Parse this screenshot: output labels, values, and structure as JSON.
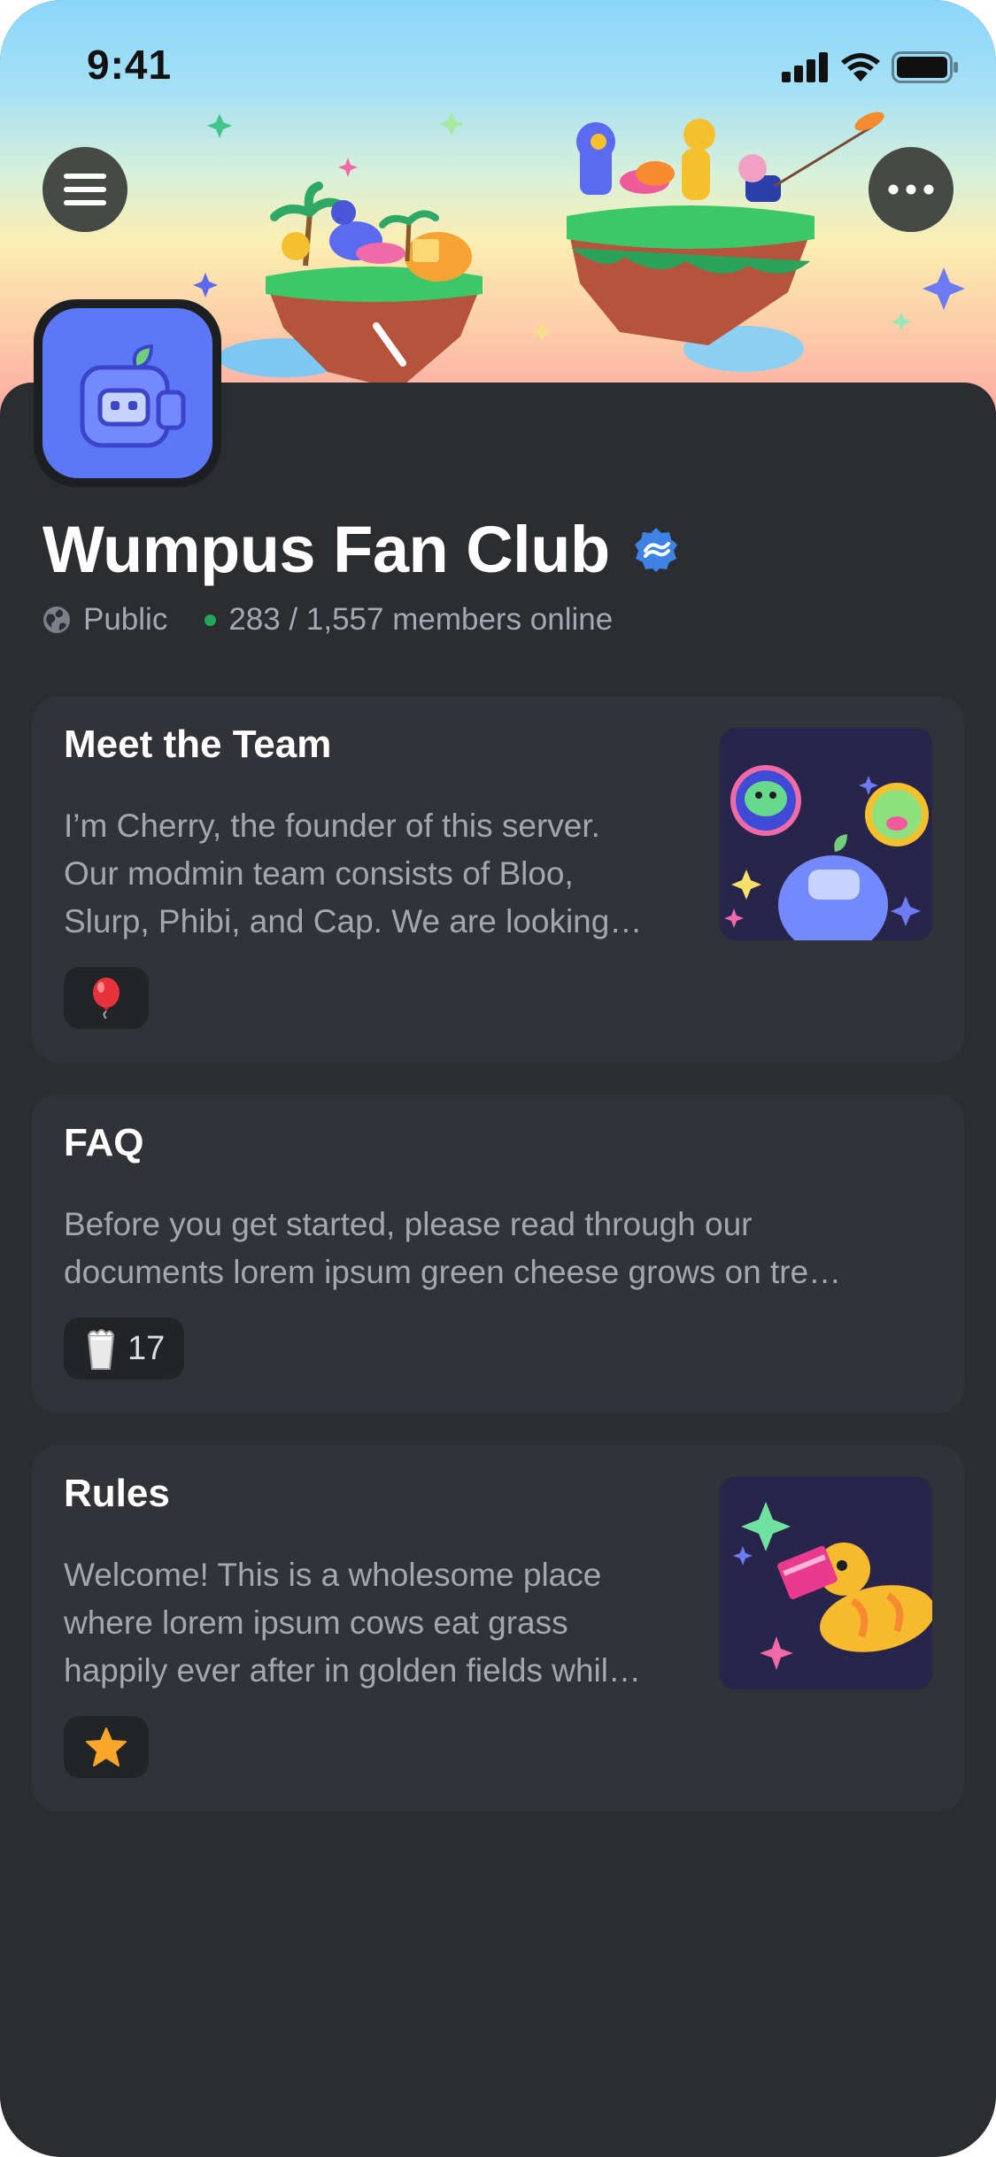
{
  "status_bar": {
    "time": "9:41"
  },
  "banner": {
    "illustration": "wumpus-floating-islands"
  },
  "header": {
    "menu_icon": "hamburger-icon",
    "more_icon": "more-horizontal-icon"
  },
  "server": {
    "name": "Wumpus Fan Club",
    "verified_icon": "partner-badge-icon",
    "visibility": "Public",
    "members_online": "283 / 1,557 members online",
    "online_color": "#23a55a"
  },
  "posts": [
    {
      "title": "Meet the Team",
      "body_lines": [
        "I’m Cherry, the founder of this server.",
        "Our modmin team consists of Bloo,",
        "Slurp, Phibi, and Cap. We are looking…"
      ],
      "reaction_emoji": "balloon",
      "reaction_count": "",
      "has_thumbnail": true
    },
    {
      "title": "FAQ",
      "body_lines": [
        "Before you get started, please read through our",
        "documents lorem ipsum green cheese grows on tre…"
      ],
      "reaction_emoji": "milk-glass",
      "reaction_count": "17",
      "has_thumbnail": false
    },
    {
      "title": "Rules",
      "body_lines": [
        "Welcome! This is a wholesome place",
        "where lorem ipsum cows eat grass",
        "happily ever after in golden fields whil…"
      ],
      "reaction_emoji": "star",
      "reaction_count": "",
      "has_thumbnail": true
    }
  ],
  "colors": {
    "background": "#2b2d31",
    "card": "#313338",
    "accent": "#5d78f7",
    "verified": "#3e82e5"
  }
}
